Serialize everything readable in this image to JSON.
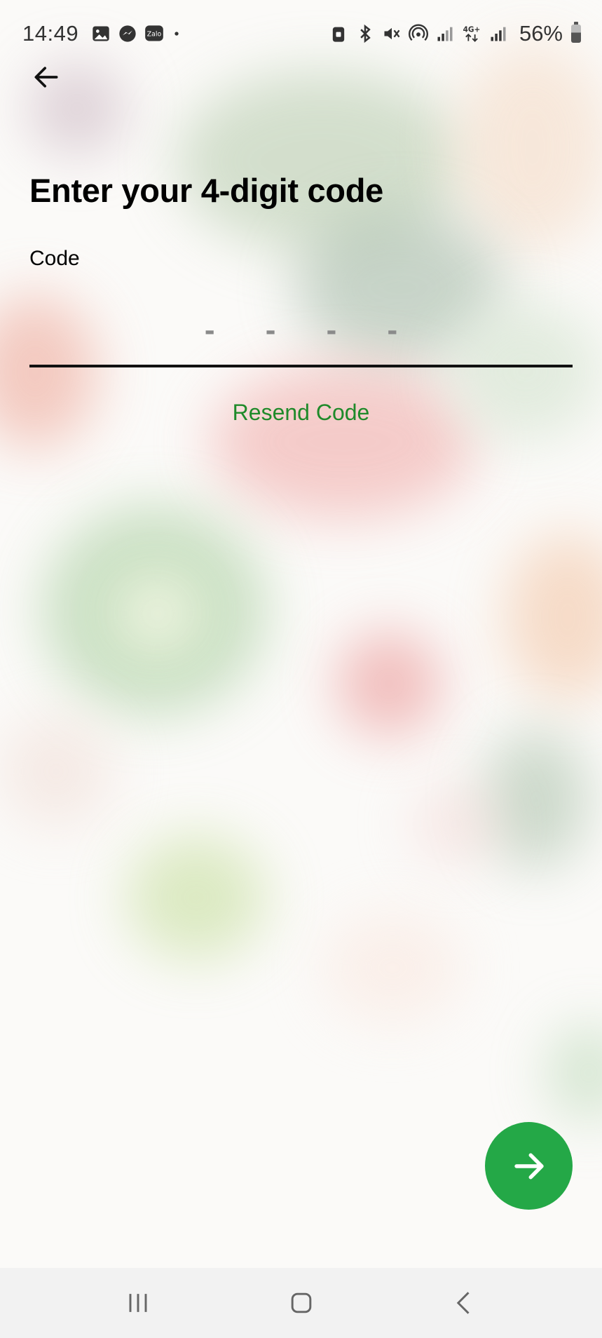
{
  "status_bar": {
    "time": "14:49",
    "battery_percent": "56%",
    "battery_level": 0.56,
    "left_icons": [
      "gallery-icon",
      "messenger-icon",
      "zalo-icon",
      "dot-icon"
    ],
    "right_icons": [
      "vpn-lock-icon",
      "bluetooth-icon",
      "mute-icon",
      "hotspot-icon",
      "signal-icon",
      "4g-icon",
      "signal-icon"
    ],
    "zalo_label": "Zalo",
    "network_label": "4G+"
  },
  "header": {
    "back_icon": "arrow-left-icon"
  },
  "main": {
    "title": "Enter your 4-digit code",
    "code_label": "Code",
    "code_placeholder": "- - - -",
    "code_value": "",
    "resend_label": "Resend Code"
  },
  "fab": {
    "icon": "arrow-right-icon"
  },
  "colors": {
    "accent": "#24a847",
    "link": "#1f8a2a",
    "placeholder": "#8a8a8a"
  },
  "nav_bar": {
    "icons": [
      "recent-apps-icon",
      "home-icon",
      "back-icon"
    ]
  }
}
